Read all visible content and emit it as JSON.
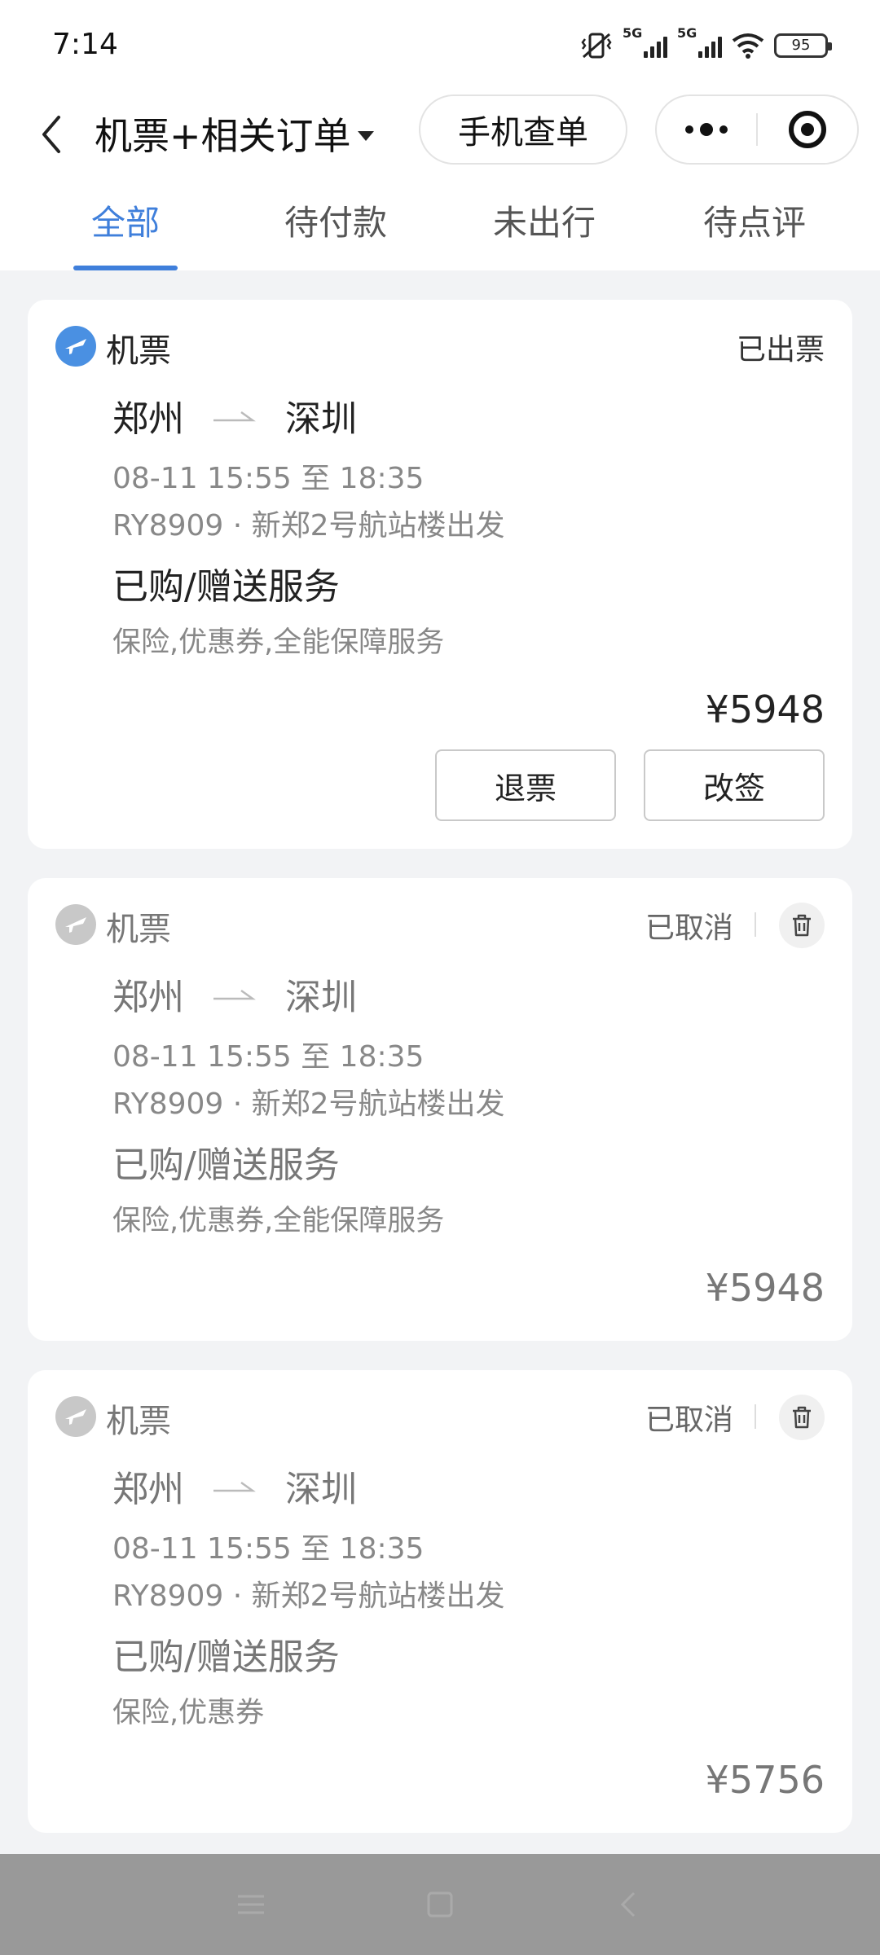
{
  "status_bar": {
    "time": "7:14",
    "signal_1_label": "5G",
    "signal_2_label": "5G",
    "battery": "95"
  },
  "header": {
    "title": "机票+相关订单",
    "query_button": "手机查单"
  },
  "tabs": [
    {
      "label": "全部",
      "active": true
    },
    {
      "label": "待付款",
      "active": false
    },
    {
      "label": "未出行",
      "active": false
    },
    {
      "label": "待点评",
      "active": false
    }
  ],
  "orders": [
    {
      "type": "机票",
      "status": "已出票",
      "from": "郑州",
      "to": "深圳",
      "datetime": "08-11 15:55 至 18:35",
      "flight": "RY8909 · 新郑2号航站楼出发",
      "services_title": "已购/赠送服务",
      "services": "保险,优惠券,全能保障服务",
      "price": "¥5948",
      "actions": [
        "退票",
        "改签"
      ]
    },
    {
      "type": "机票",
      "status": "已取消",
      "from": "郑州",
      "to": "深圳",
      "datetime": "08-11 15:55 至 18:35",
      "flight": "RY8909 · 新郑2号航站楼出发",
      "services_title": "已购/赠送服务",
      "services": "保险,优惠券,全能保障服务",
      "price": "¥5948"
    },
    {
      "type": "机票",
      "status": "已取消",
      "from": "郑州",
      "to": "深圳",
      "datetime": "08-11 15:55 至 18:35",
      "flight": "RY8909 · 新郑2号航站楼出发",
      "services_title": "已购/赠送服务",
      "services": "保险,优惠券",
      "price": "¥5756"
    }
  ],
  "colors": {
    "accent": "#3f7fdb",
    "plane_icon_active": "#4a90e2",
    "plane_icon_muted": "#c8c8c8"
  }
}
